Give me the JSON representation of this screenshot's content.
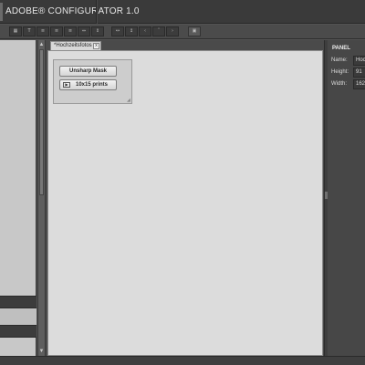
{
  "app": {
    "title": "ADOBE® CONFIGURATOR 1.0"
  },
  "toolbar": {
    "buttons": [
      {
        "icon": "grid-icon",
        "glyph": "▦"
      },
      {
        "icon": "text-icon",
        "glyph": "T"
      },
      {
        "icon": "align-left-icon",
        "glyph": "≡"
      },
      {
        "icon": "align-center-icon",
        "glyph": "≡"
      },
      {
        "icon": "align-right-icon",
        "glyph": "≡"
      },
      {
        "icon": "distribute-h-icon",
        "glyph": "⇔"
      },
      {
        "icon": "distribute-v-icon",
        "glyph": "⇕"
      },
      {
        "icon": "equal-width-icon",
        "glyph": "↔"
      },
      {
        "icon": "equal-height-icon",
        "glyph": "↕"
      },
      {
        "icon": "move-left-icon",
        "glyph": "‹"
      },
      {
        "icon": "move-up-icon",
        "glyph": "ˆ"
      },
      {
        "icon": "move-right-icon",
        "glyph": "›"
      },
      {
        "icon": "preview-icon",
        "glyph": "▣"
      }
    ]
  },
  "document": {
    "tab_label": "*Hochzeitsfotos",
    "tab_close": "x",
    "widget": {
      "button1_label": "Unsharp Mask",
      "button2_label": "10x15 prints"
    }
  },
  "panel": {
    "title": "PANEL",
    "name_label": "Name:",
    "name_value": "Hoc",
    "height_label": "Height:",
    "height_value": "91",
    "width_label": "Width:",
    "width_value": "162"
  }
}
